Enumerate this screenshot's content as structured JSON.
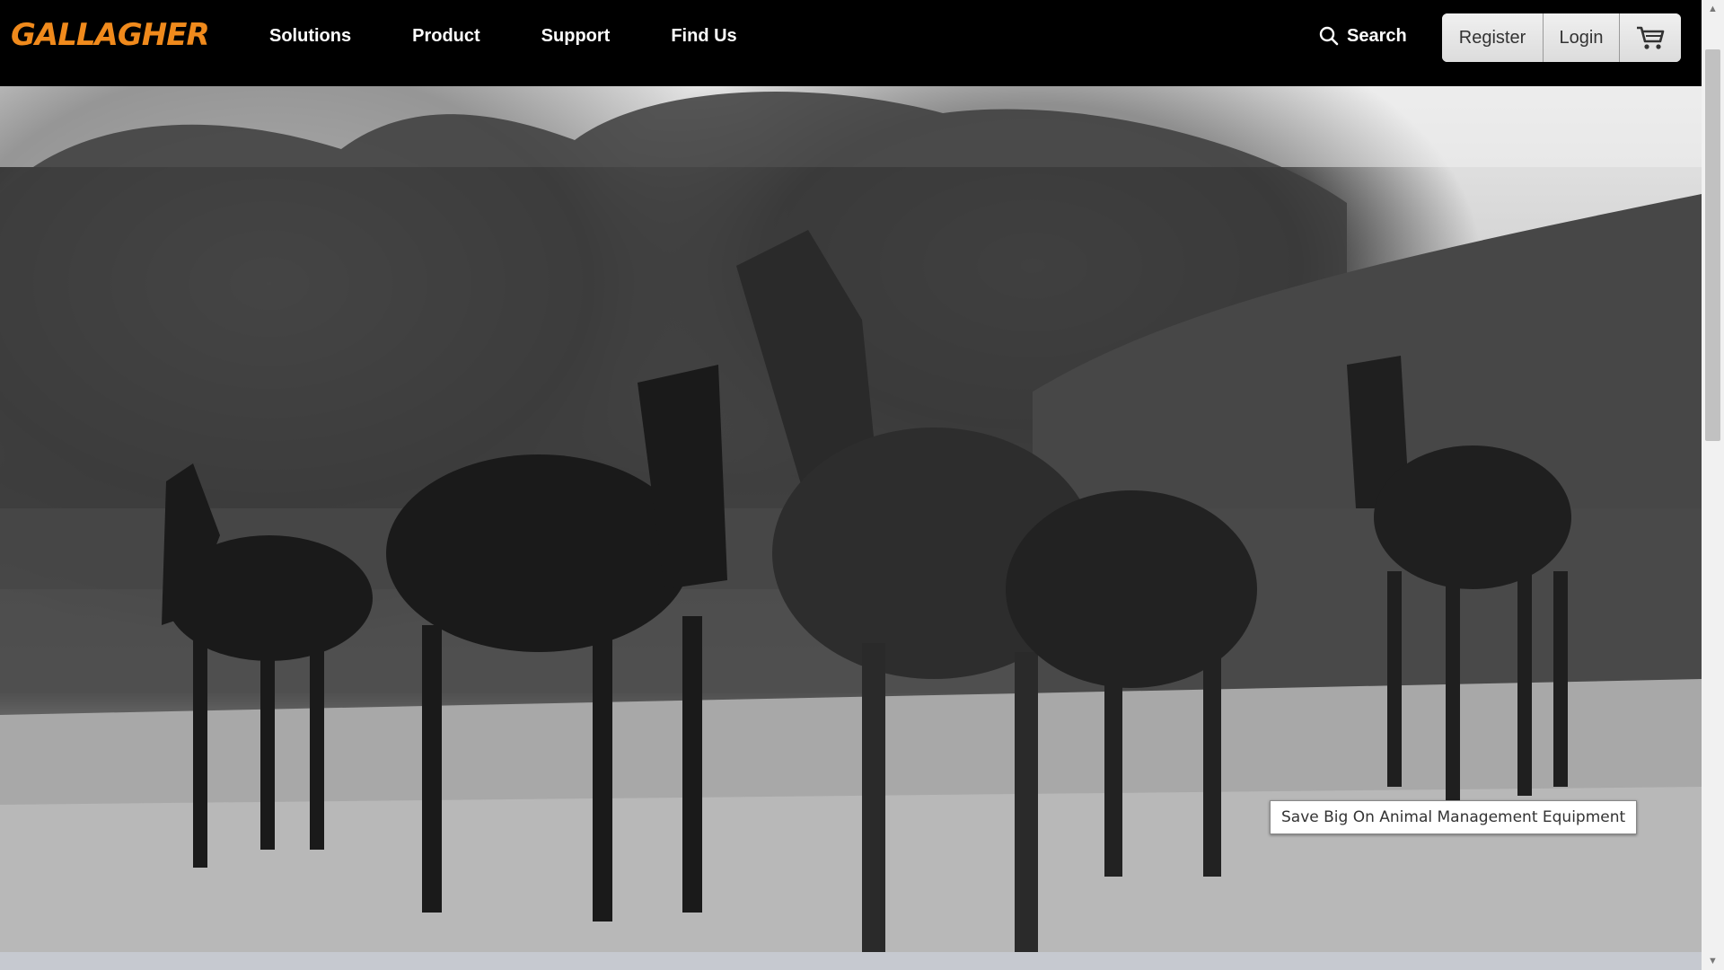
{
  "brand": {
    "name": "GALLAGHER",
    "color": "#f08a1c"
  },
  "nav": {
    "items": [
      {
        "label": "Solutions"
      },
      {
        "label": "Product"
      },
      {
        "label": "Support"
      },
      {
        "label": "Find Us"
      }
    ]
  },
  "header": {
    "search_label": "Search",
    "register_label": "Register",
    "login_label": "Login",
    "cart_icon": "cart-icon"
  },
  "hero": {
    "image": "black-and-white photo of horses in a field",
    "caption": "Save Big On Animal Management Equipment"
  },
  "colors": {
    "header_bg": "#000000",
    "accent": "#f08a1c"
  }
}
